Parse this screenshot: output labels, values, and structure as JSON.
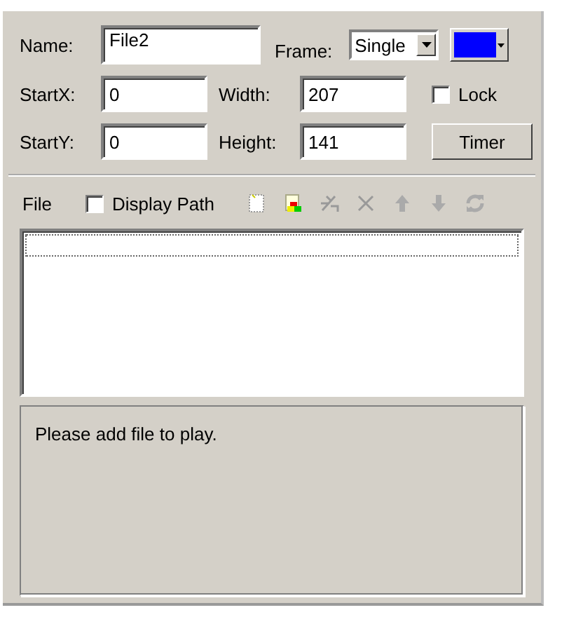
{
  "properties": {
    "name_label": "Name:",
    "name_value": "File2",
    "frame_label": "Frame:",
    "frame_value": "Single",
    "frame_color": {
      "color": "#0000ff"
    },
    "startx_label": "StartX:",
    "startx_value": "0",
    "width_label": "Width:",
    "width_value": "207",
    "lock": {
      "label": "Lock",
      "checked": false
    },
    "starty_label": "StartY:",
    "starty_value": "0",
    "height_label": "Height:",
    "height_value": "141",
    "timer_button": "Timer"
  },
  "file_bar": {
    "label": "File",
    "display_path": {
      "label": "Display Path",
      "checked": false
    }
  },
  "message": "Please add file to play."
}
